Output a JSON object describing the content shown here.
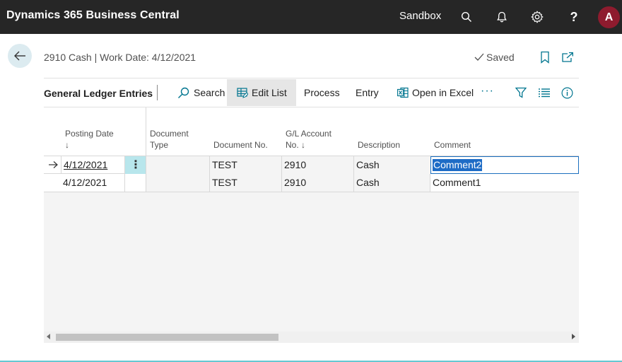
{
  "topbar": {
    "app_title": "Dynamics 365 Business Central",
    "environment": "Sandbox",
    "avatar_initial": "A",
    "avatar_color": "#8e1b2e"
  },
  "header": {
    "page_title": "2910 Cash | Work Date: 4/12/2021",
    "saved_label": "Saved"
  },
  "actionbar": {
    "section_title": "General Ledger Entries",
    "search_label": "Search",
    "edit_list_label": "Edit List",
    "process_label": "Process",
    "entry_label": "Entry",
    "open_excel_label": "Open in Excel",
    "more_label": "···"
  },
  "grid": {
    "columns": [
      {
        "line1": "Posting Date",
        "line2": "↓"
      },
      {
        "line1": "Document",
        "line2": "Type"
      },
      {
        "line1": "",
        "line2": "Document No."
      },
      {
        "line1": "G/L Account",
        "line2": "No. ↓"
      },
      {
        "line1": "",
        "line2": "Description"
      },
      {
        "line1": "",
        "line2": "Comment"
      }
    ],
    "rows": [
      {
        "posting_date": "4/12/2021",
        "document_type": "",
        "document_no": "TEST",
        "gl_account_no": "2910",
        "description": "Cash",
        "comment": "Comment2",
        "selected": true
      },
      {
        "posting_date": "4/12/2021",
        "document_type": "",
        "document_no": "TEST",
        "gl_account_no": "2910",
        "description": "Cash",
        "comment": "Comment1",
        "selected": false
      }
    ]
  },
  "colors": {
    "topbar": "#262626",
    "accent": "#00758f",
    "selection": "#1e6cc6",
    "context_cell": "#b8e6ec"
  }
}
